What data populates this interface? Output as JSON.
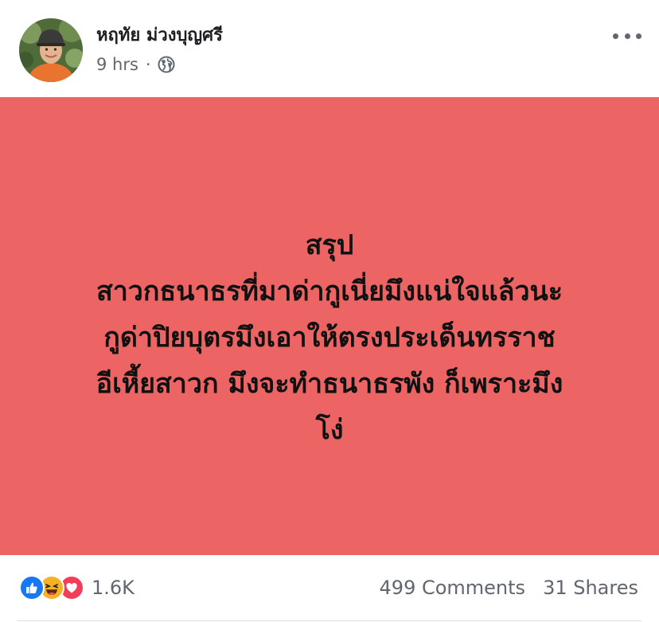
{
  "post": {
    "author_name": "หฤทัย ม่วงบุญศรี",
    "timestamp": "9 hrs",
    "separator": "·",
    "privacy_icon": "globe-icon",
    "more_icon": "more-options-icon",
    "background_color": "#ec6564",
    "text_lines": [
      "สรุป",
      "สาวกธนาธรที่มาด่ากูเนี่ยมึงแน่ใจแล้วนะ",
      "กูด่าปิยบุตรมึงเอาให้ตรงประเด็นทรราช",
      "อีเหี้ยสาวก มึงจะทำธนาธรพัง ก็เพราะมึง",
      "โง่"
    ]
  },
  "engagement": {
    "reaction_icons": [
      "like-icon",
      "haha-icon",
      "love-icon"
    ],
    "reaction_count": "1.6K",
    "comments": "499 Comments",
    "shares": "31 Shares"
  }
}
